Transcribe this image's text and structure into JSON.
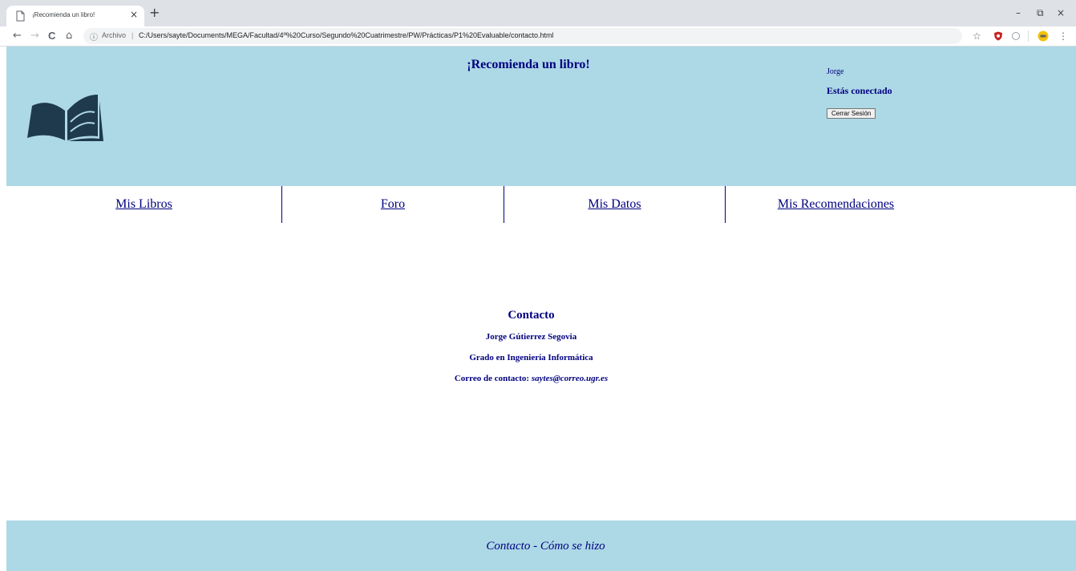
{
  "browser": {
    "tab_title": "¡Recomienda un libro!",
    "tab_close": "×",
    "new_tab": "+",
    "window_minimize": "–",
    "window_restore": "⧉",
    "window_close": "×",
    "back": "←",
    "forward": "→",
    "reload": "C",
    "home": "⌂",
    "info": "ⓘ",
    "security_label": "Archivo",
    "separator": "|",
    "url": "C:/Users/sayte/Documents/MEGA/Facultad/4º%20Curso/Segundo%20Cuatrimestre/PW/Prácticas/P1%20Evaluable/contacto.html",
    "star": "☆",
    "menu": "⋮"
  },
  "header": {
    "title": "¡Recomienda un libro!",
    "user_name": "Jorge",
    "status": "Estás conectado",
    "logout_label": "Cerrar Sesión"
  },
  "nav": {
    "items": [
      {
        "label": "Mis Libros"
      },
      {
        "label": "Foro"
      },
      {
        "label": "Mis Datos"
      },
      {
        "label": "Mis Recomendaciones"
      }
    ]
  },
  "contact": {
    "heading": "Contacto",
    "name": "Jorge Gútierrez Segovia",
    "degree": "Grado en Ingeniería Informática",
    "email_label": "Correo de contacto:",
    "email": "saytes@correo.ugr.es"
  },
  "footer": {
    "text": "Contacto - Cómo se hizo"
  },
  "colors": {
    "header_bg": "#add8e6",
    "text": "#000080",
    "logo": "#1f3a4d"
  }
}
